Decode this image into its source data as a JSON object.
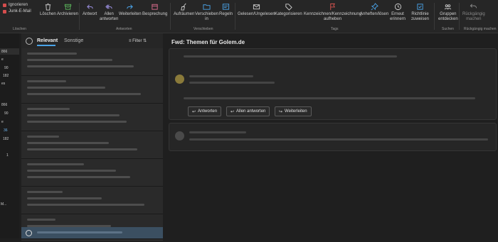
{
  "ribbon": {
    "small": [
      {
        "label": "Ignorieren",
        "color": "#d54d4d"
      },
      {
        "label": "Junk-E-Mail",
        "color": "#d54d4d"
      }
    ],
    "buttons": {
      "loeschen": "Löschen",
      "archivieren": "Archivieren",
      "antwort": "Antwort",
      "allen_antworten": "Allen\nantworten",
      "weiterleiten": "Weiterleiten",
      "besprechung": "Besprechung",
      "aufraeumen": "Aufräumen",
      "verschieben": "Verschieben\nin",
      "regeln": "Regeln",
      "gelesen": "Gelesen/Ungelesen",
      "kategorisieren": "Kategorisieren",
      "kennzeichnen": "Kennzeichnen/Kennzeichnung\naufheben",
      "anheften": "Anheften/lösen",
      "erneut": "Erneut\nerinnern",
      "richtlinie": "Richtlinie\nzuweisen",
      "gruppen": "Gruppen\nentdecken",
      "rueckgaengig": "Rückgängig\nmachen"
    },
    "groups": {
      "loeschen": "Löschen",
      "antworten": "Antworten",
      "verschieben": "Verschieben",
      "tags": "Tags",
      "suchen": "Suchen",
      "rueckgaengig": "Rückgängig machen"
    }
  },
  "folders": [
    "866",
    "e",
    "90",
    "182",
    "es",
    "866",
    "90",
    "e",
    "36",
    "182",
    "1",
    "M..."
  ],
  "list": {
    "tab_relevant": "Relevant",
    "tab_sonstige": "Sonstige",
    "filter": "Filter"
  },
  "reading": {
    "subject": "Fwd: Themen für Golem.de",
    "reply": "Antworten",
    "reply_all": "Allen antworten",
    "forward": "Weiterleiten"
  },
  "colors": {
    "accent": "#4aa3e8",
    "flag": "#d9534f",
    "archive": "#5cb85c"
  }
}
